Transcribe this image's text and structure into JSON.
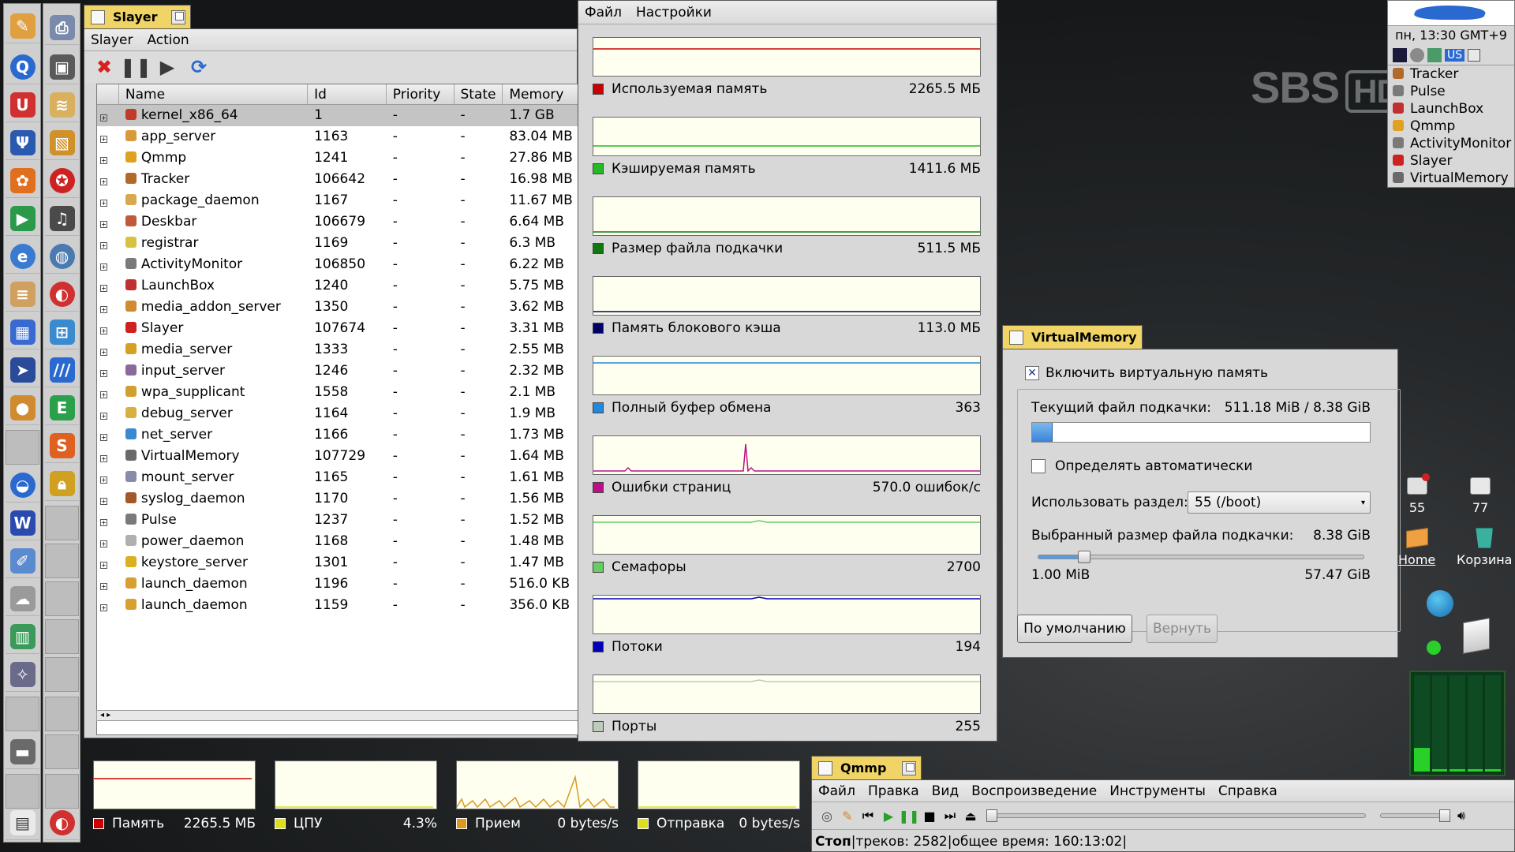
{
  "desktop": {
    "watermark_main": "SBS",
    "watermark_badge": "HD",
    "icons": [
      {
        "label": "55"
      },
      {
        "label": "77"
      },
      {
        "label": "Home"
      },
      {
        "label": "Корзина"
      }
    ]
  },
  "deskbar": {
    "clock": "пн, 13:30 GMT+9",
    "keymap": "US",
    "apps": [
      "Tracker",
      "Pulse",
      "LaunchBox",
      "Qmmp",
      "ActivityMonitor",
      "Slayer",
      "VirtualMemory"
    ]
  },
  "slayer": {
    "title": "Slayer",
    "menu": [
      "Slayer",
      "Action"
    ],
    "columns": [
      "Name",
      "Id",
      "Priority",
      "State",
      "Memory"
    ],
    "rows": [
      {
        "name": "kernel_x86_64",
        "id": "1",
        "priority": "-",
        "state": "-",
        "memory": "1.7 GB",
        "color": "#c23a2a"
      },
      {
        "name": "app_server",
        "id": "1163",
        "priority": "-",
        "state": "-",
        "memory": "83.04 MB",
        "color": "#d99a3a"
      },
      {
        "name": "Qmmp",
        "id": "1241",
        "priority": "-",
        "state": "-",
        "memory": "27.86 MB",
        "color": "#e0a020"
      },
      {
        "name": "Tracker",
        "id": "106642",
        "priority": "-",
        "state": "-",
        "memory": "16.98 MB",
        "color": "#b06a2a"
      },
      {
        "name": "package_daemon",
        "id": "1167",
        "priority": "-",
        "state": "-",
        "memory": "11.67 MB",
        "color": "#d8a850"
      },
      {
        "name": "Deskbar",
        "id": "106679",
        "priority": "-",
        "state": "-",
        "memory": "6.64 MB",
        "color": "#c05a3a"
      },
      {
        "name": "registrar",
        "id": "1169",
        "priority": "-",
        "state": "-",
        "memory": "6.3 MB",
        "color": "#d8c040"
      },
      {
        "name": "ActivityMonitor",
        "id": "106850",
        "priority": "-",
        "state": "-",
        "memory": "6.22 MB",
        "color": "#7a7a7a"
      },
      {
        "name": "LaunchBox",
        "id": "1240",
        "priority": "-",
        "state": "-",
        "memory": "5.75 MB",
        "color": "#c03030"
      },
      {
        "name": "media_addon_server",
        "id": "1350",
        "priority": "-",
        "state": "-",
        "memory": "3.62 MB",
        "color": "#d08a30"
      },
      {
        "name": "Slayer",
        "id": "107674",
        "priority": "-",
        "state": "-",
        "memory": "3.31 MB",
        "color": "#cc2222"
      },
      {
        "name": "media_server",
        "id": "1333",
        "priority": "-",
        "state": "-",
        "memory": "2.55 MB",
        "color": "#d8a020"
      },
      {
        "name": "input_server",
        "id": "1246",
        "priority": "-",
        "state": "-",
        "memory": "2.32 MB",
        "color": "#8a6a9a"
      },
      {
        "name": "wpa_supplicant",
        "id": "1558",
        "priority": "-",
        "state": "-",
        "memory": "2.1 MB",
        "color": "#d0a030"
      },
      {
        "name": "debug_server",
        "id": "1164",
        "priority": "-",
        "state": "-",
        "memory": "1.9 MB",
        "color": "#d8b040"
      },
      {
        "name": "net_server",
        "id": "1166",
        "priority": "-",
        "state": "-",
        "memory": "1.73 MB",
        "color": "#3a8ad0"
      },
      {
        "name": "VirtualMemory",
        "id": "107729",
        "priority": "-",
        "state": "-",
        "memory": "1.64 MB",
        "color": "#6a6a6a"
      },
      {
        "name": "mount_server",
        "id": "1165",
        "priority": "-",
        "state": "-",
        "memory": "1.61 MB",
        "color": "#8a8aaa"
      },
      {
        "name": "syslog_daemon",
        "id": "1170",
        "priority": "-",
        "state": "-",
        "memory": "1.56 MB",
        "color": "#a05a2a"
      },
      {
        "name": "Pulse",
        "id": "1237",
        "priority": "-",
        "state": "-",
        "memory": "1.52 MB",
        "color": "#7a7a7a"
      },
      {
        "name": "power_daemon",
        "id": "1168",
        "priority": "-",
        "state": "-",
        "memory": "1.48 MB",
        "color": "#b0b0b0"
      },
      {
        "name": "keystore_server",
        "id": "1301",
        "priority": "-",
        "state": "-",
        "memory": "1.47 MB",
        "color": "#d8b020"
      },
      {
        "name": "launch_daemon",
        "id": "1196",
        "priority": "-",
        "state": "-",
        "memory": "516.0 KB",
        "color": "#d8a030"
      },
      {
        "name": "launch_daemon",
        "id": "1159",
        "priority": "-",
        "state": "-",
        "memory": "356.0 KB",
        "color": "#d8a030"
      }
    ]
  },
  "activity_monitor": {
    "menu": [
      "Файл",
      "Настройки"
    ],
    "items": [
      {
        "label": "Используемая память",
        "value": "2265.5 МБ",
        "color": "#cc0000"
      },
      {
        "label": "Кэшируемая память",
        "value": "1411.6 МБ",
        "color": "#22bb22"
      },
      {
        "label": "Размер файла подкачки",
        "value": "511.5 МБ",
        "color": "#117711"
      },
      {
        "label": "Память блокового кэша",
        "value": "113.0 МБ",
        "color": "#000066"
      },
      {
        "label": "Полный буфер обмена",
        "value": "363",
        "color": "#2288dd"
      },
      {
        "label": "Ошибки страниц",
        "value": "570.0 ошибок/с",
        "color": "#bb1188"
      },
      {
        "label": "Семафоры",
        "value": "2700",
        "color": "#66cc66"
      },
      {
        "label": "Потоки",
        "value": "194",
        "color": "#0000bb"
      },
      {
        "label": "Порты",
        "value": "255",
        "color": "#bbccbb"
      }
    ]
  },
  "virtual_memory": {
    "title": "VirtualMemory",
    "enable_label": "Включить виртуальную память",
    "enable_checked": "✕",
    "current_label": "Текущий файл подкачки:",
    "current_value": "511.18 MiB / 8.38 GiB",
    "current_fraction": 0.06,
    "auto_label": "Определять автоматически",
    "partition_label": "Использовать раздел:",
    "partition_value": "55 (/boot)",
    "size_label": "Выбранный размер файла подкачки:",
    "size_value": "8.38 GiB",
    "slider_fraction": 0.14,
    "slider_min": "1.00 MiB",
    "slider_max": "57.47 GiB",
    "default_button": "По умолчанию",
    "revert_button": "Вернуть"
  },
  "mini_monitors": [
    {
      "label": "Память",
      "value": "2265.5 МБ",
      "color": "#cc0000"
    },
    {
      "label": "ЦПУ",
      "value": "4.3%",
      "color": "#dddd22"
    },
    {
      "label": "Прием",
      "value": "0 bytes/s",
      "color": "#d89a22"
    },
    {
      "label": "Отправка",
      "value": "0 bytes/s",
      "color": "#dddd22"
    }
  ],
  "qmmp": {
    "title": "Qmmp",
    "menu": [
      "Файл",
      "Правка",
      "Вид",
      "Воспроизведение",
      "Инструменты",
      "Справка"
    ],
    "status": "Стоп",
    "tracks": "треков: 2582",
    "total_time": "общее время: 160:13:02",
    "separator": "|"
  },
  "colors": {
    "tab_active": "#f0d466",
    "window_bg": "#d8d8d8",
    "graph_bg": "#fffff0"
  }
}
